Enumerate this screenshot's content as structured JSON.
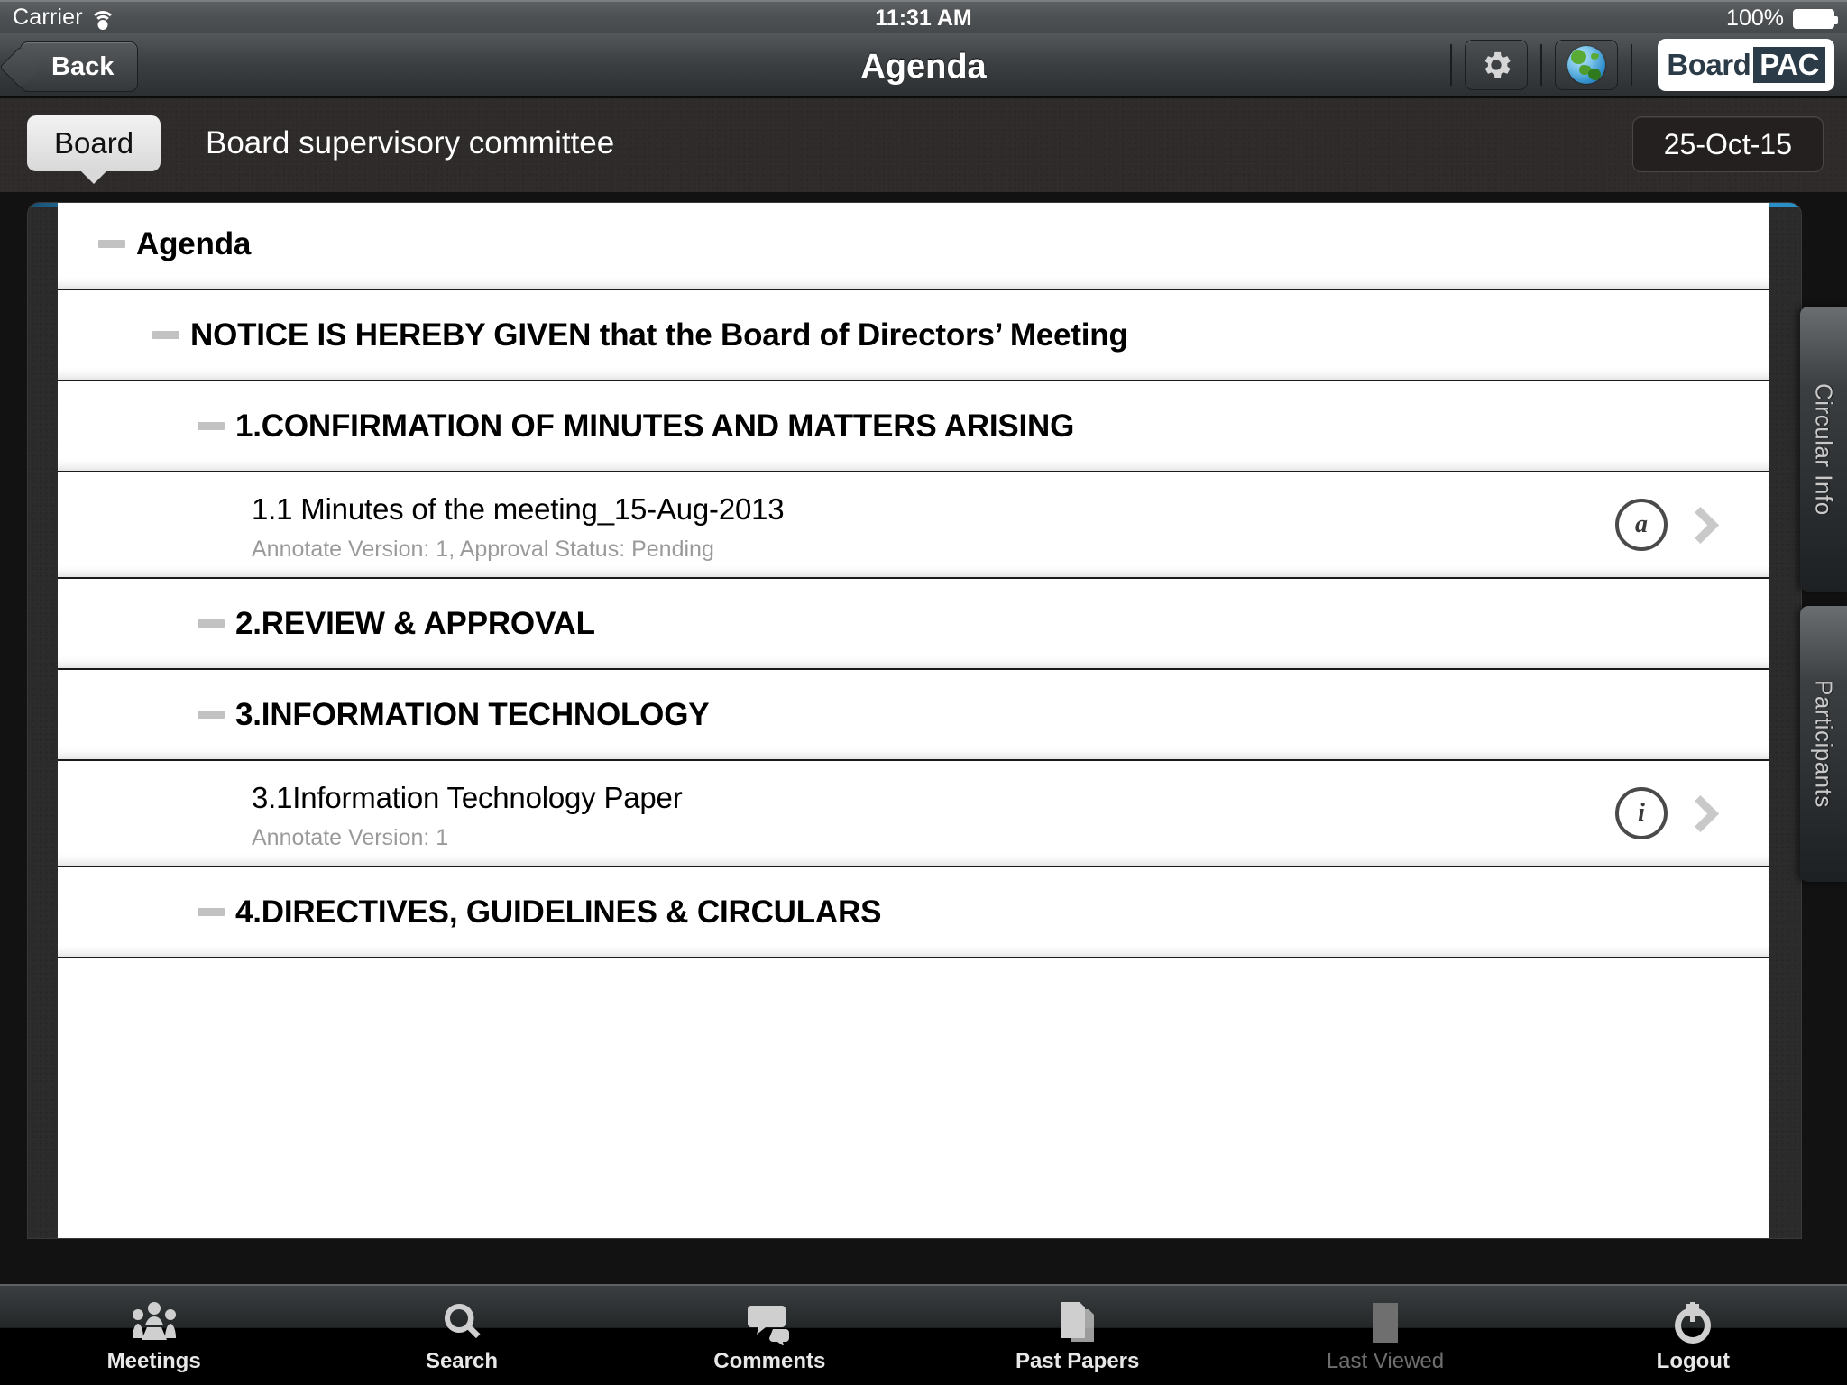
{
  "status_bar": {
    "carrier": "Carrier",
    "wifi_icon": "wifi-icon",
    "time": "11:31 AM",
    "battery_percent": "100%",
    "battery_icon": "battery-full-icon"
  },
  "nav_bar": {
    "back_label": "Back",
    "title": "Agenda",
    "settings_icon": "gear-icon",
    "globe_icon": "globe-icon",
    "brand": {
      "part1": "Board",
      "part2": "PAC"
    }
  },
  "breadcrumb": {
    "tab_label": "Board",
    "committee": "Board supervisory committee",
    "date": "25-Oct-15"
  },
  "accent_color": "#2a8fc7",
  "agenda": {
    "rows": [
      {
        "type": "header",
        "indent": 0,
        "title": "Agenda"
      },
      {
        "type": "header",
        "indent": 1,
        "title": "NOTICE IS HEREBY GIVEN that the Board of Directors’ Meeting"
      },
      {
        "type": "header",
        "indent": 2,
        "title": "1.CONFIRMATION OF MINUTES AND MATTERS ARISING"
      },
      {
        "type": "document",
        "title": "1.1 Minutes of the meeting_15-Aug-2013",
        "subtitle": "Annotate Version: 1, Approval Status: Pending",
        "icon": "annotation-at-icon",
        "icon_glyph": "a",
        "chevron": "chevron-right-icon"
      },
      {
        "type": "header",
        "indent": 2,
        "title": "2.REVIEW & APPROVAL"
      },
      {
        "type": "header",
        "indent": 2,
        "title": "3.INFORMATION TECHNOLOGY"
      },
      {
        "type": "document",
        "title": "3.1Information Technology Paper",
        "subtitle": "Annotate Version: 1",
        "icon": "info-circle-icon",
        "icon_glyph": "i",
        "chevron": "chevron-right-icon"
      },
      {
        "type": "header",
        "indent": 2,
        "title": "4.DIRECTIVES, GUIDELINES & CIRCULARS"
      }
    ]
  },
  "side_tabs": [
    {
      "id": "circular-info",
      "label": "Circular Info"
    },
    {
      "id": "participants",
      "label": "Participants"
    }
  ],
  "toolbar": {
    "items": [
      {
        "id": "meetings",
        "label": "Meetings",
        "icon": "meetings-icon",
        "disabled": false
      },
      {
        "id": "search",
        "label": "Search",
        "icon": "search-icon",
        "disabled": false
      },
      {
        "id": "comments",
        "label": "Comments",
        "icon": "comment-icon",
        "disabled": false
      },
      {
        "id": "past-papers",
        "label": "Past Papers",
        "icon": "documents-icon",
        "disabled": false
      },
      {
        "id": "last-viewed",
        "label": "Last Viewed",
        "icon": "bookmark-icon",
        "disabled": true
      },
      {
        "id": "logout",
        "label": "Logout",
        "icon": "power-icon",
        "disabled": false
      }
    ]
  }
}
